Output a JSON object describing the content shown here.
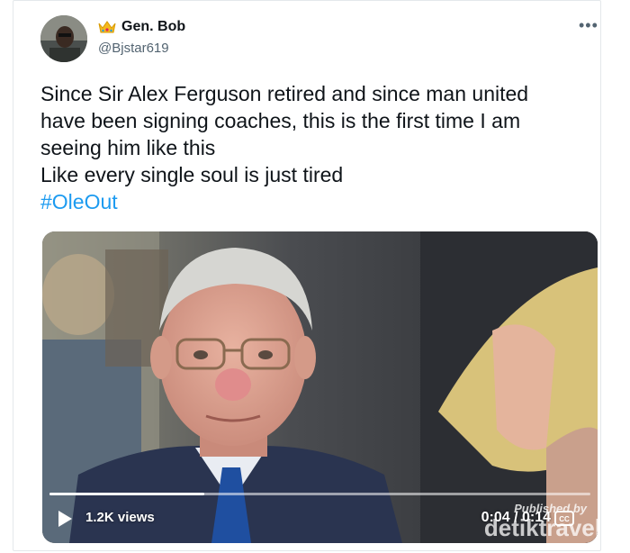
{
  "tweet": {
    "display_name": "Gen. Bob",
    "handle": "@Bjstar619",
    "crown_icon": "crown-emoji",
    "more_icon": "more-dots-icon",
    "more_label": "•••",
    "text_lines": [
      "Since Sir Alex Ferguson retired and since man united",
      "have been signing coaches, this is the first time I am",
      "seeing him like this",
      "Like every single soul is just tired"
    ],
    "hashtag": "#OleOut"
  },
  "video": {
    "views": "1.2K views",
    "time": "0:04 / 0:14",
    "progress": 0.2857,
    "play_icon": "play-icon",
    "cc_icon": "captions-icon",
    "watermark_caption": "Published by",
    "watermark_brand": "detiktravel"
  },
  "colors": {
    "link": "#1d9bf0",
    "secondary_text": "#536471",
    "border": "#e4e8eb"
  }
}
